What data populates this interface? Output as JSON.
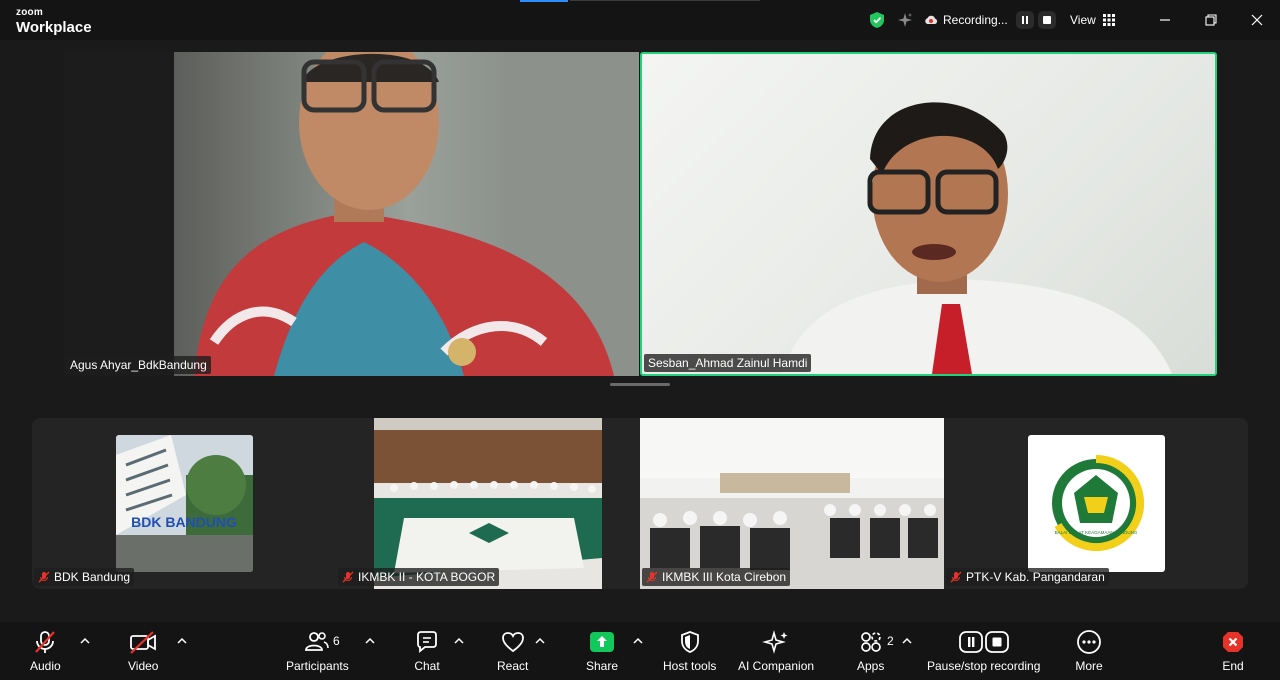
{
  "app": {
    "brand_small": "zoom",
    "brand_large": "Workplace"
  },
  "titlebar": {
    "recording_label": "Recording...",
    "view_label": "View"
  },
  "main_tiles": [
    {
      "name": "Agus Ahyar_BdkBandung"
    },
    {
      "name": "Sesban_Ahmad Zainul Hamdi"
    }
  ],
  "gallery": [
    {
      "name": "BDK Bandung",
      "image_text": "BDK BANDUNG"
    },
    {
      "name": "IKMBK II - KOTA BOGOR"
    },
    {
      "name": "IKMBK III Kota Cirebon"
    },
    {
      "name": "PTK-V Kab. Pangandaran",
      "logo_text": "BALAI DIKLAT KEAGAMAAN BANDUNG"
    }
  ],
  "toolbar": {
    "audio": "Audio",
    "video": "Video",
    "participants": "Participants",
    "participants_count": "6",
    "chat": "Chat",
    "react": "React",
    "share": "Share",
    "host_tools": "Host tools",
    "ai_companion": "AI Companion",
    "apps": "Apps",
    "apps_count": "2",
    "recording": "Pause/stop recording",
    "more": "More",
    "end": "End"
  },
  "colors": {
    "active_speaker": "#22d17a",
    "share_green": "#12c85a",
    "end_red": "#e5332a",
    "muted_red": "#e5332a"
  }
}
